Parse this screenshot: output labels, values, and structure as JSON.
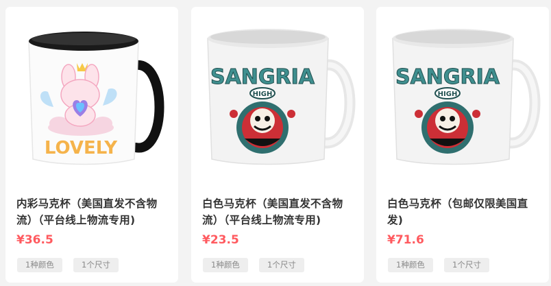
{
  "products": [
    {
      "image_icon": "mug-black-inner-lovely-bunny",
      "title": "内彩马克杯（美国直发不含物流）（平台线上物流专用)",
      "price": "¥36.5",
      "tags": [
        "1种颜色",
        "1个尺寸"
      ],
      "print_text": "LOVELY"
    },
    {
      "image_icon": "mug-white-sangria-high",
      "title": "白色马克杯（美国直发不含物流）（平台线上物流专用)",
      "price": "¥23.5",
      "tags": [
        "1种颜色",
        "1个尺寸"
      ],
      "print_text": "SANGRIA",
      "print_badge": "HIGH"
    },
    {
      "image_icon": "mug-white-sangria-high",
      "title": "白色马克杯（包邮仅限美国直发)",
      "price": "¥71.6",
      "tags": [
        "1种颜色",
        "1个尺寸"
      ],
      "print_text": "SANGRIA",
      "print_badge": "HIGH"
    }
  ]
}
